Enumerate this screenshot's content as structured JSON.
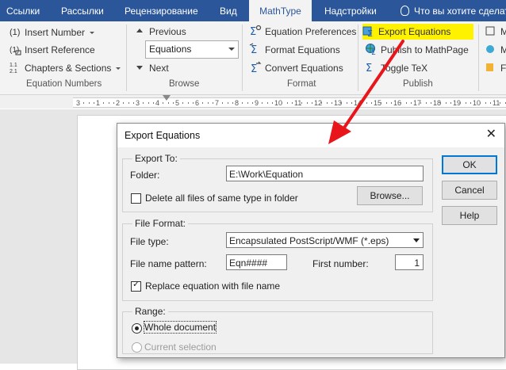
{
  "ribbon_tabs": [
    "Ссылки",
    "Рассылки",
    "Рецензирование",
    "Вид",
    "MathType",
    "Надстройки",
    "Что вы хотите сделать"
  ],
  "active_tab": "MathType",
  "groups": {
    "equation_numbers": {
      "label": "Equation Numbers",
      "insert_number": "Insert Number",
      "insert_reference": "Insert Reference",
      "chapters_sections": "Chapters & Sections"
    },
    "browse": {
      "label": "Browse",
      "previous": "Previous",
      "combo_value": "Equations",
      "next": "Next"
    },
    "format": {
      "label": "Format",
      "equation_preferences": "Equation Preferences",
      "format_equations": "Format Equations",
      "convert_equations": "Convert Equations"
    },
    "publish": {
      "label": "Publish",
      "export_equations": "Export Equations",
      "publish_mathpage": "Publish to MathPage",
      "toggle_tex": "Toggle TeX"
    },
    "overflow": {
      "m1": "M",
      "m2": "M",
      "m3": "Fu"
    }
  },
  "ruler_numbers": [
    "3",
    "1",
    "2",
    "3",
    "4",
    "5",
    "6",
    "7",
    "8",
    "9",
    "10",
    "11",
    "12",
    "13",
    "14",
    "15",
    "16",
    "17",
    "18",
    "19",
    "10",
    "11"
  ],
  "dialog": {
    "title": "Export Equations",
    "export_to": {
      "legend": "Export To:",
      "folder_label": "Folder:",
      "folder_value": "E:\\Work\\Equation",
      "delete_label": "Delete all files of same type in folder",
      "delete_checked": false,
      "browse_button": "Browse..."
    },
    "file_format": {
      "legend": "File Format:",
      "file_type_label": "File type:",
      "file_type_value": "Encapsulated PostScript/WMF (*.eps)",
      "pattern_label": "File name pattern:",
      "pattern_value": "Eqn####",
      "first_number_label": "First number:",
      "first_number_value": "1",
      "replace_label": "Replace equation with file name",
      "replace_checked": true
    },
    "range": {
      "legend": "Range:",
      "whole_document": "Whole document",
      "current_selection": "Current selection",
      "selected": "whole_document"
    },
    "buttons": {
      "ok": "OK",
      "cancel": "Cancel",
      "help": "Help"
    }
  },
  "colors": {
    "ribbon_blue": "#2b579a",
    "highlight": "#fff200",
    "arrow": "#e8161b"
  }
}
